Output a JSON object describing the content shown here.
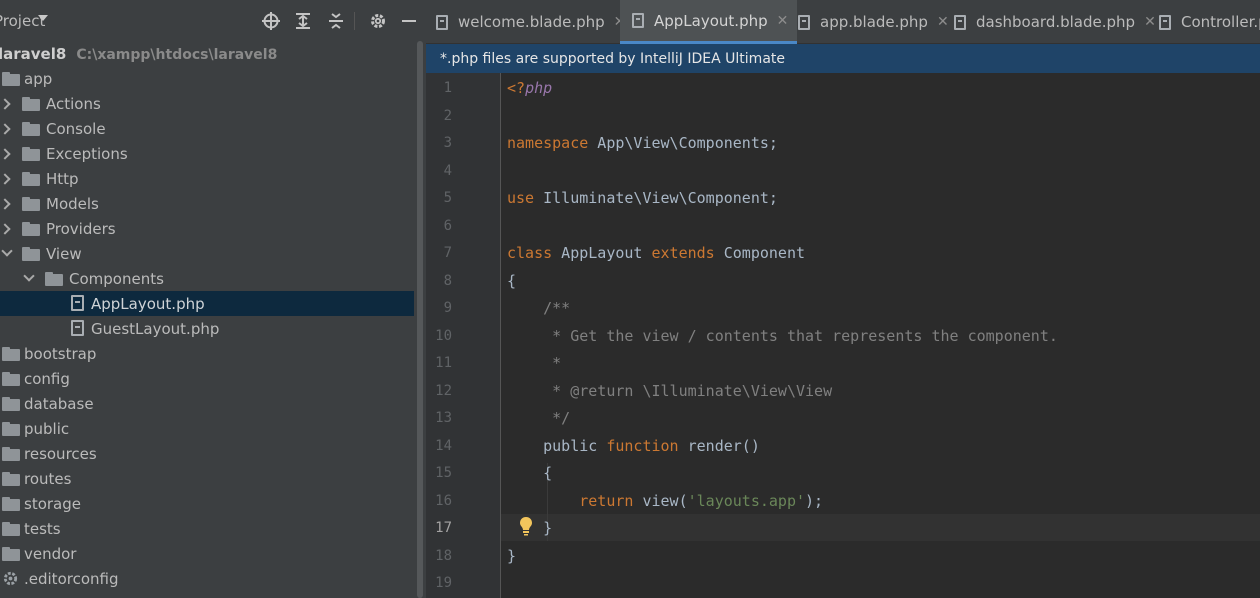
{
  "project_panel": {
    "title": "Project"
  },
  "tree": [
    {
      "label": "laravel8",
      "hint": "C:\\xampp\\htdocs\\laravel8",
      "type": "root"
    },
    {
      "label": "app",
      "type": "folder",
      "state": "open"
    },
    {
      "label": "Actions",
      "type": "folder",
      "state": "closed"
    },
    {
      "label": "Console",
      "type": "folder",
      "state": "closed"
    },
    {
      "label": "Exceptions",
      "type": "folder",
      "state": "closed"
    },
    {
      "label": "Http",
      "type": "folder",
      "state": "closed"
    },
    {
      "label": "Models",
      "type": "folder",
      "state": "closed"
    },
    {
      "label": "Providers",
      "type": "folder",
      "state": "closed"
    },
    {
      "label": "View",
      "type": "folder",
      "state": "open"
    },
    {
      "label": "Components",
      "type": "folder",
      "state": "open"
    },
    {
      "label": "AppLayout.php",
      "type": "file",
      "selected": true
    },
    {
      "label": "GuestLayout.php",
      "type": "file"
    },
    {
      "label": "bootstrap",
      "type": "folder"
    },
    {
      "label": "config",
      "type": "folder"
    },
    {
      "label": "database",
      "type": "folder"
    },
    {
      "label": "public",
      "type": "folder"
    },
    {
      "label": "resources",
      "type": "folder"
    },
    {
      "label": "routes",
      "type": "folder"
    },
    {
      "label": "storage",
      "type": "folder"
    },
    {
      "label": "tests",
      "type": "folder"
    },
    {
      "label": "vendor",
      "type": "folder"
    },
    {
      "label": ".editorconfig",
      "type": "config-file"
    }
  ],
  "tabs": [
    {
      "label": "welcome.blade.php",
      "close": "✕"
    },
    {
      "label": "AppLayout.php",
      "close": "✕",
      "active": true
    },
    {
      "label": "app.blade.php",
      "close": "✕"
    },
    {
      "label": "dashboard.blade.php",
      "close": "✕"
    },
    {
      "label": "Controller.php"
    }
  ],
  "banner": "*.php files are supported by IntelliJ IDEA Ultimate",
  "line_numbers": [
    "1",
    "2",
    "3",
    "4",
    "5",
    "6",
    "7",
    "8",
    "9",
    "10",
    "11",
    "12",
    "13",
    "14",
    "15",
    "16",
    "17",
    "18",
    "19"
  ],
  "current_line": "17",
  "code": {
    "l1_open": "<?",
    "l1_php": "php",
    "l3_kw": "namespace",
    "l3_rest": " App\\View\\Components;",
    "l5_kw": "use",
    "l5_rest": " Illuminate\\View\\Component;",
    "l7_kw1": "class",
    "l7_name": " AppLayout ",
    "l7_kw2": "extends",
    "l7_rest": " Component",
    "l8": "{",
    "l9": "    /**",
    "l10": "     * Get the view / contents that represents the component.",
    "l11": "     *",
    "l12": "     * @return \\Illuminate\\View\\View",
    "l13": "     */",
    "l14_a": "    public ",
    "l14_kw": "function",
    "l14_b": " render()",
    "l15": "    {",
    "l16_indent": "        ",
    "l16_kw": "return",
    "l16_a": " view(",
    "l16_str": "'layouts.app'",
    "l16_b": ");",
    "l17": "    }",
    "l18": "}"
  },
  "colors": {
    "keyword": "#cc7832",
    "string": "#6a8759",
    "comment": "#808080",
    "selection": "#0d293e",
    "banner": "#1f4468"
  }
}
